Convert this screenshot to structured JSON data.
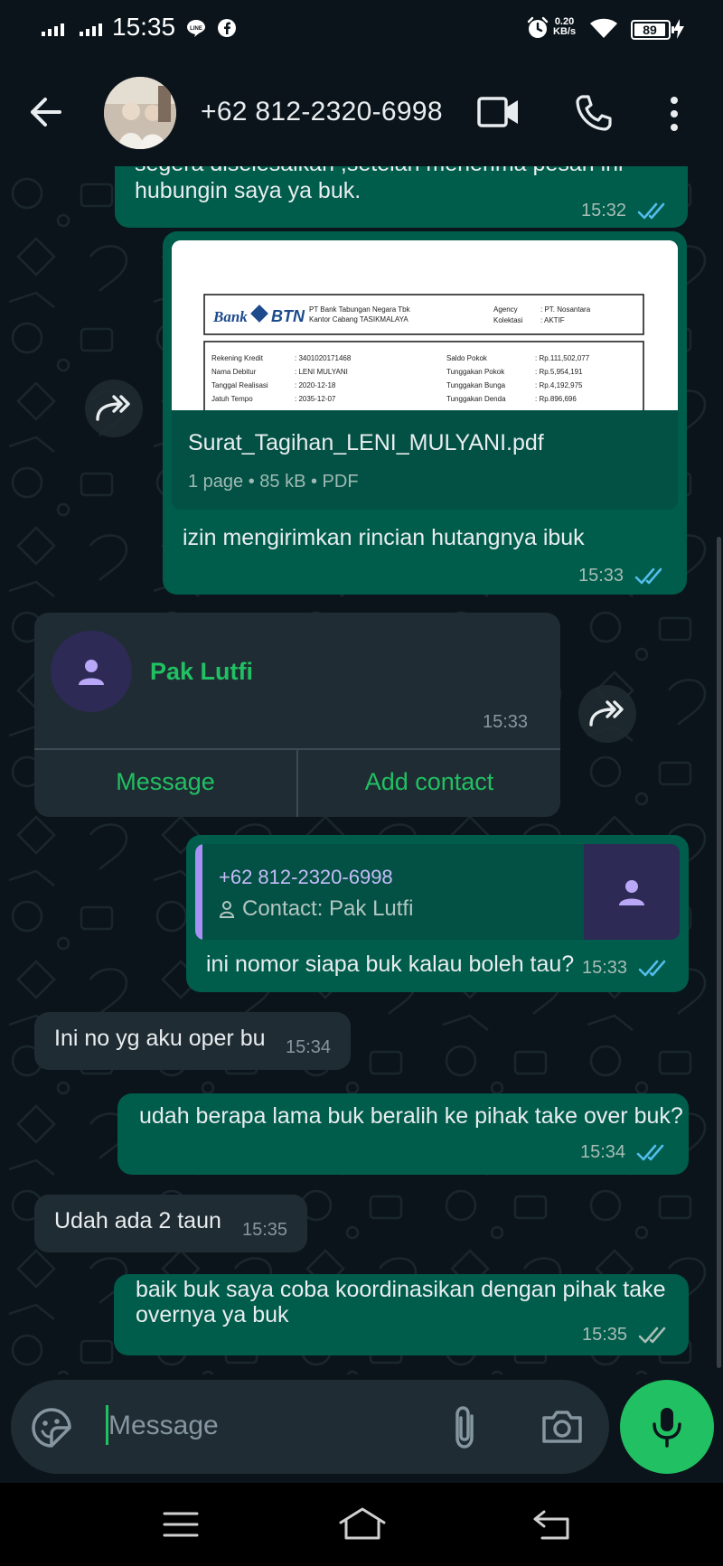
{
  "status_bar": {
    "time": "15:35",
    "network_speed_value": "0.20",
    "network_speed_unit": "KB/s",
    "battery": "89"
  },
  "header": {
    "contact_name": "+62 812-2320-6998"
  },
  "messages": {
    "m1": {
      "text_line1": "segera diselesaikan ,setelah menerima pesan ini",
      "text_line2": "hubungin saya ya buk.",
      "time": "15:32"
    },
    "pdf": {
      "doc_bank": "Bank",
      "doc_brand": "BTN",
      "doc_org": "PT Bank Tabungan Negara Tbk",
      "doc_branch": "Kantor Cabang TASIKMALAYA",
      "doc_agency_label": "Agency",
      "doc_agency_value": ": PT. Nosantara",
      "doc_status_label": "Kolektasi",
      "doc_status_value": ": AKTIF",
      "doc_rows": [
        {
          "l": "Rekening Kredit",
          "v": ": 3401020171468",
          "l2": "Saldo Pokok",
          "v2": ": Rp.111,502,077"
        },
        {
          "l": "Nama Debitur",
          "v": ": LENI MULYANI",
          "l2": "Tunggakan Pokok",
          "v2": ": Rp.5,954,191"
        },
        {
          "l": "Tanggal Realisasi",
          "v": ": 2020-12-18",
          "l2": "Tunggakan Bunga",
          "v2": ": Rp.4,192,975"
        },
        {
          "l": "Jatuh Tempo",
          "v": ": 2035-12-07",
          "l2": "Tunggakan Denda",
          "v2": ": Rp.896,696"
        }
      ],
      "file_name": "Surat_Tagihan_LENI_MULYANI.pdf",
      "file_meta": "1 page • 85 kB • PDF",
      "caption": "izin mengirimkan rincian hutangnya ibuk",
      "time": "15:33"
    },
    "contact_card": {
      "name": "Pak Lutfi",
      "time": "15:33",
      "action_message": "Message",
      "action_add": "Add contact"
    },
    "reply_contact": {
      "quoted_number": "+62 812-2320-6998",
      "quoted_sub": "Contact: Pak Lutfi",
      "text": "ini nomor siapa buk kalau boleh tau?",
      "time": "15:33"
    },
    "in1": {
      "text": "Ini no yg aku oper bu",
      "time": "15:34"
    },
    "out2": {
      "text": "udah berapa lama buk beralih ke pihak take over buk?",
      "time": "15:34"
    },
    "in2": {
      "text": "Udah ada 2 taun",
      "time": "15:35"
    },
    "out3": {
      "text_line1": "baik buk saya coba koordinasikan dengan pihak take",
      "text_line2": "overnya ya buk",
      "time": "15:35"
    }
  },
  "composer": {
    "placeholder": "Message"
  },
  "colors": {
    "accent": "#21c063",
    "outgoing_bubble": "#005c4b",
    "incoming_bubble": "#202c33",
    "read_ticks": "#53bdeb",
    "background": "#0b141a"
  },
  "icons": {
    "back": "back-arrow-icon",
    "video": "video-call-icon",
    "call": "phone-icon",
    "menu": "more-vertical-icon",
    "forward": "forward-icon",
    "emoji": "sticker-icon",
    "attach": "paperclip-icon",
    "camera": "camera-icon",
    "mic": "microphone-icon"
  }
}
